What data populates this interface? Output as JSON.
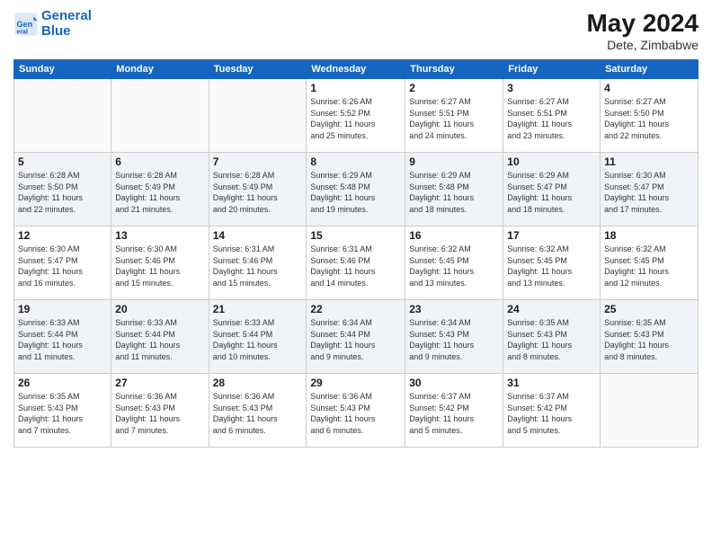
{
  "header": {
    "logo_line1": "General",
    "logo_line2": "Blue",
    "month_year": "May 2024",
    "location": "Dete, Zimbabwe"
  },
  "days_of_week": [
    "Sunday",
    "Monday",
    "Tuesday",
    "Wednesday",
    "Thursday",
    "Friday",
    "Saturday"
  ],
  "weeks": [
    [
      {
        "day": "",
        "info": ""
      },
      {
        "day": "",
        "info": ""
      },
      {
        "day": "",
        "info": ""
      },
      {
        "day": "1",
        "info": "Sunrise: 6:26 AM\nSunset: 5:52 PM\nDaylight: 11 hours\nand 25 minutes."
      },
      {
        "day": "2",
        "info": "Sunrise: 6:27 AM\nSunset: 5:51 PM\nDaylight: 11 hours\nand 24 minutes."
      },
      {
        "day": "3",
        "info": "Sunrise: 6:27 AM\nSunset: 5:51 PM\nDaylight: 11 hours\nand 23 minutes."
      },
      {
        "day": "4",
        "info": "Sunrise: 6:27 AM\nSunset: 5:50 PM\nDaylight: 11 hours\nand 22 minutes."
      }
    ],
    [
      {
        "day": "5",
        "info": "Sunrise: 6:28 AM\nSunset: 5:50 PM\nDaylight: 11 hours\nand 22 minutes."
      },
      {
        "day": "6",
        "info": "Sunrise: 6:28 AM\nSunset: 5:49 PM\nDaylight: 11 hours\nand 21 minutes."
      },
      {
        "day": "7",
        "info": "Sunrise: 6:28 AM\nSunset: 5:49 PM\nDaylight: 11 hours\nand 20 minutes."
      },
      {
        "day": "8",
        "info": "Sunrise: 6:29 AM\nSunset: 5:48 PM\nDaylight: 11 hours\nand 19 minutes."
      },
      {
        "day": "9",
        "info": "Sunrise: 6:29 AM\nSunset: 5:48 PM\nDaylight: 11 hours\nand 18 minutes."
      },
      {
        "day": "10",
        "info": "Sunrise: 6:29 AM\nSunset: 5:47 PM\nDaylight: 11 hours\nand 18 minutes."
      },
      {
        "day": "11",
        "info": "Sunrise: 6:30 AM\nSunset: 5:47 PM\nDaylight: 11 hours\nand 17 minutes."
      }
    ],
    [
      {
        "day": "12",
        "info": "Sunrise: 6:30 AM\nSunset: 5:47 PM\nDaylight: 11 hours\nand 16 minutes."
      },
      {
        "day": "13",
        "info": "Sunrise: 6:30 AM\nSunset: 5:46 PM\nDaylight: 11 hours\nand 15 minutes."
      },
      {
        "day": "14",
        "info": "Sunrise: 6:31 AM\nSunset: 5:46 PM\nDaylight: 11 hours\nand 15 minutes."
      },
      {
        "day": "15",
        "info": "Sunrise: 6:31 AM\nSunset: 5:46 PM\nDaylight: 11 hours\nand 14 minutes."
      },
      {
        "day": "16",
        "info": "Sunrise: 6:32 AM\nSunset: 5:45 PM\nDaylight: 11 hours\nand 13 minutes."
      },
      {
        "day": "17",
        "info": "Sunrise: 6:32 AM\nSunset: 5:45 PM\nDaylight: 11 hours\nand 13 minutes."
      },
      {
        "day": "18",
        "info": "Sunrise: 6:32 AM\nSunset: 5:45 PM\nDaylight: 11 hours\nand 12 minutes."
      }
    ],
    [
      {
        "day": "19",
        "info": "Sunrise: 6:33 AM\nSunset: 5:44 PM\nDaylight: 11 hours\nand 11 minutes."
      },
      {
        "day": "20",
        "info": "Sunrise: 6:33 AM\nSunset: 5:44 PM\nDaylight: 11 hours\nand 11 minutes."
      },
      {
        "day": "21",
        "info": "Sunrise: 6:33 AM\nSunset: 5:44 PM\nDaylight: 11 hours\nand 10 minutes."
      },
      {
        "day": "22",
        "info": "Sunrise: 6:34 AM\nSunset: 5:44 PM\nDaylight: 11 hours\nand 9 minutes."
      },
      {
        "day": "23",
        "info": "Sunrise: 6:34 AM\nSunset: 5:43 PM\nDaylight: 11 hours\nand 9 minutes."
      },
      {
        "day": "24",
        "info": "Sunrise: 6:35 AM\nSunset: 5:43 PM\nDaylight: 11 hours\nand 8 minutes."
      },
      {
        "day": "25",
        "info": "Sunrise: 6:35 AM\nSunset: 5:43 PM\nDaylight: 11 hours\nand 8 minutes."
      }
    ],
    [
      {
        "day": "26",
        "info": "Sunrise: 6:35 AM\nSunset: 5:43 PM\nDaylight: 11 hours\nand 7 minutes."
      },
      {
        "day": "27",
        "info": "Sunrise: 6:36 AM\nSunset: 5:43 PM\nDaylight: 11 hours\nand 7 minutes."
      },
      {
        "day": "28",
        "info": "Sunrise: 6:36 AM\nSunset: 5:43 PM\nDaylight: 11 hours\nand 6 minutes."
      },
      {
        "day": "29",
        "info": "Sunrise: 6:36 AM\nSunset: 5:43 PM\nDaylight: 11 hours\nand 6 minutes."
      },
      {
        "day": "30",
        "info": "Sunrise: 6:37 AM\nSunset: 5:42 PM\nDaylight: 11 hours\nand 5 minutes."
      },
      {
        "day": "31",
        "info": "Sunrise: 6:37 AM\nSunset: 5:42 PM\nDaylight: 11 hours\nand 5 minutes."
      },
      {
        "day": "",
        "info": ""
      }
    ]
  ]
}
